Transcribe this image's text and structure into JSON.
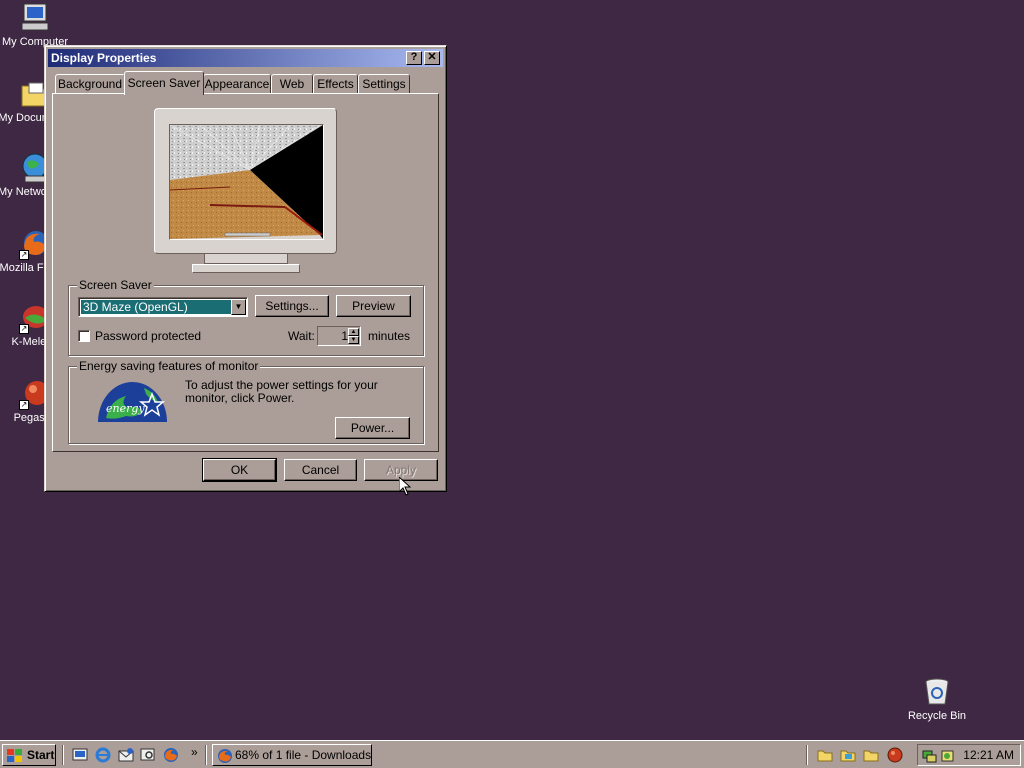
{
  "desktop": {
    "icons": [
      {
        "label": "My Computer"
      },
      {
        "label": "My Documents"
      },
      {
        "label": "My Network Places"
      },
      {
        "label": "Mozilla Firefox"
      },
      {
        "label": "K-Meleon"
      },
      {
        "label": "Pegasus"
      },
      {
        "label": "Recycle Bin"
      }
    ]
  },
  "window": {
    "title": "Display Properties",
    "help_btn": "?",
    "close_btn": "✕",
    "tabs": [
      {
        "label": "Background"
      },
      {
        "label": "Screen Saver"
      },
      {
        "label": "Appearance"
      },
      {
        "label": "Web"
      },
      {
        "label": "Effects"
      },
      {
        "label": "Settings"
      }
    ],
    "active_tab": "Screen Saver",
    "screensaver_group": {
      "title": "Screen Saver",
      "selected": "3D Maze (OpenGL)",
      "settings_btn": "Settings...",
      "preview_btn": "Preview",
      "password_label": "Password protected",
      "password_checked": false,
      "wait_label": "Wait:",
      "wait_value": "1",
      "wait_unit": "minutes"
    },
    "energy_group": {
      "title": "Energy saving features of monitor",
      "text": "To adjust the power settings for your monitor, click Power.",
      "power_btn": "Power..."
    },
    "ok_btn": "OK",
    "cancel_btn": "Cancel",
    "apply_btn": "Apply"
  },
  "taskbar": {
    "start_label": "Start",
    "quicklaunch_more": "»",
    "task_label": "68% of 1 file - Downloads",
    "clock": "12:21 AM"
  },
  "colors": {
    "desktop": "#3f2843",
    "face": "#ab9e98",
    "title_start": "#1e2a77",
    "title_end": "#a8b9f0",
    "selection": "#1a6d73"
  }
}
